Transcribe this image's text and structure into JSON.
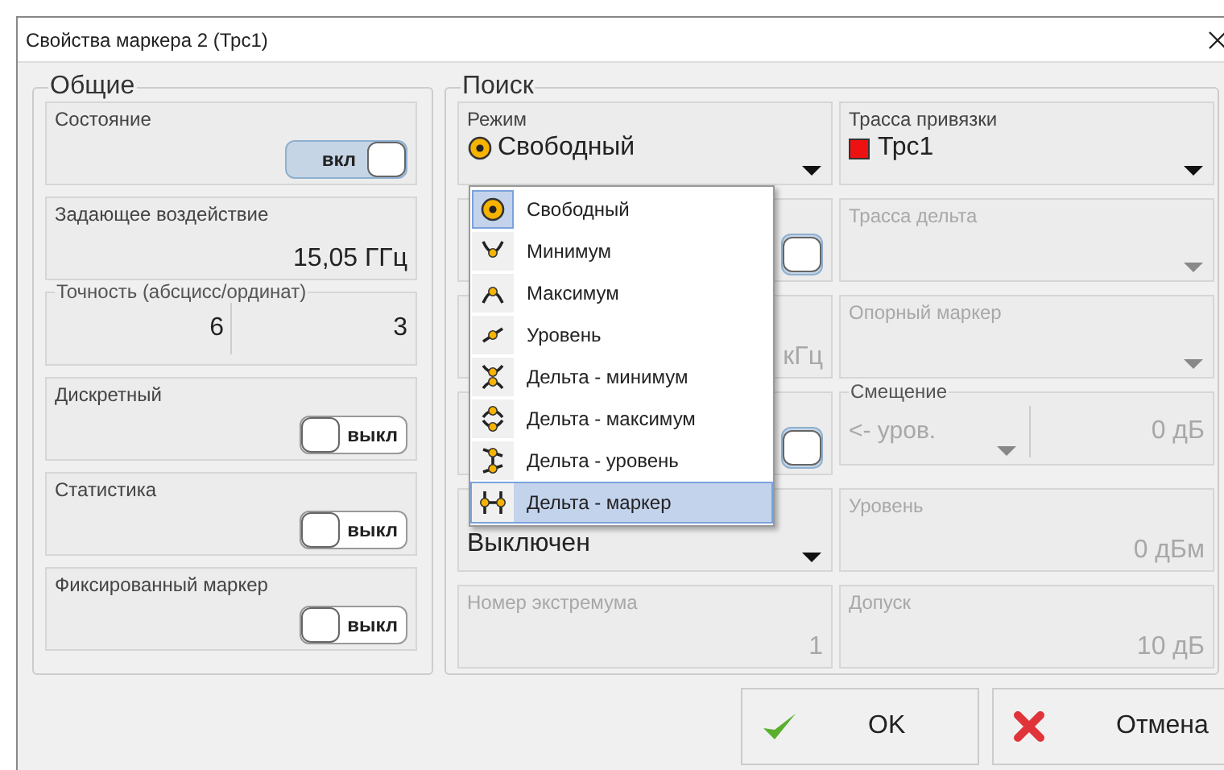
{
  "window": {
    "title": "Свойства маркера 2 (Трс1)"
  },
  "general": {
    "title": "Общие",
    "cards": [
      {
        "kind": "toggle",
        "label": "Состояние",
        "on": true,
        "text": "вкл"
      },
      {
        "kind": "value",
        "label": "Задающее воздействие",
        "value": "15,05 ГГц"
      },
      {
        "kind": "pair",
        "title": "Точность (абсцисс/ординат)",
        "values": [
          "6",
          "3"
        ]
      },
      {
        "kind": "toggle",
        "label": "Дискретный",
        "on": false,
        "text": "выкл"
      },
      {
        "kind": "toggle",
        "label": "Статистика",
        "on": false,
        "text": "выкл"
      },
      {
        "kind": "toggle",
        "label": "Фиксированный маркер",
        "on": false,
        "text": "выкл"
      }
    ]
  },
  "search": {
    "title": "Поиск",
    "mode": {
      "label": "Режим",
      "value": "Свободный",
      "kind": "free"
    },
    "trace": {
      "label": "Трасса привязки",
      "value": "Трс1",
      "color": "#ee1111"
    },
    "rows": [
      {
        "left": {
          "kind": "toggle",
          "on": true
        },
        "right": {
          "kind": "select",
          "label": "Трасса дельта",
          "disabled": true
        }
      },
      {
        "left": {
          "kind": "unit",
          "value": "кГц"
        },
        "right": {
          "kind": "select",
          "label": "Опорный маркер",
          "disabled": true
        }
      },
      {
        "left": {
          "kind": "toggle",
          "on": true
        },
        "right": {
          "kind": "offset",
          "title": "Смещение",
          "option": "<- уров.",
          "value": "0 дБ",
          "disabled": true
        }
      },
      {
        "left": {
          "kind": "select",
          "value": "Выключен",
          "disabled": false
        },
        "right": {
          "kind": "value",
          "label": "Уровень",
          "value": "0 дБм",
          "disabled": true
        }
      },
      {
        "left": {
          "kind": "value",
          "label": "Номер экстремума",
          "value": "1",
          "disabled": true
        },
        "right": {
          "kind": "value",
          "label": "Допуск",
          "value": "10 дБ",
          "disabled": true
        }
      }
    ],
    "dropdown": [
      {
        "kind": "free",
        "label": "Свободный",
        "current": true,
        "selected": false
      },
      {
        "kind": "min",
        "label": "Минимум",
        "current": false,
        "selected": false
      },
      {
        "kind": "max",
        "label": "Максимум",
        "current": false,
        "selected": false
      },
      {
        "kind": "level",
        "label": "Уровень",
        "current": false,
        "selected": false
      },
      {
        "kind": "delta-min",
        "label": "Дельта - минимум",
        "current": false,
        "selected": false
      },
      {
        "kind": "delta-max",
        "label": "Дельта - максимум",
        "current": false,
        "selected": false
      },
      {
        "kind": "delta-level",
        "label": "Дельта - уровень",
        "current": false,
        "selected": false
      },
      {
        "kind": "delta-marker",
        "label": "Дельта - маркер",
        "current": false,
        "selected": true
      }
    ]
  },
  "buttons": [
    {
      "kind": "ok",
      "label": "OK"
    },
    {
      "kind": "cancel",
      "label": "Отмена"
    }
  ]
}
